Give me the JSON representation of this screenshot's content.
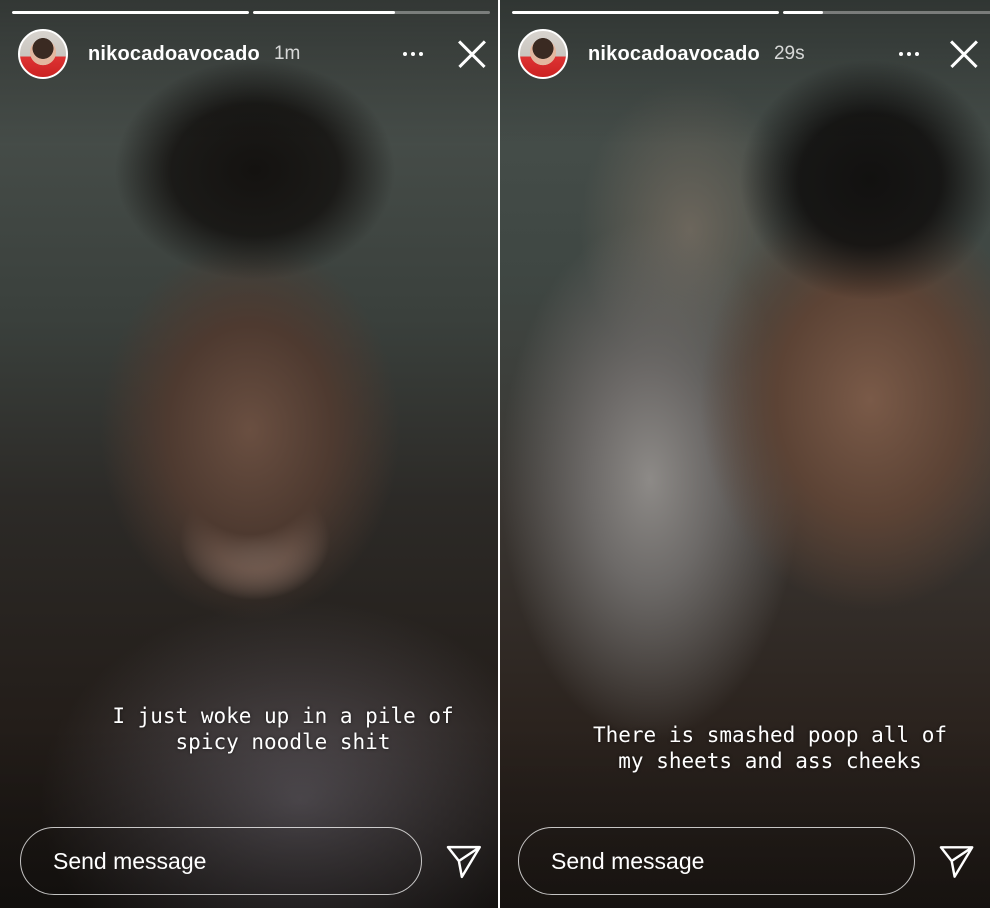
{
  "stories": [
    {
      "username": "nikocadoavocado",
      "timestamp": "1m",
      "caption": "I just woke up in a pile of\nspicy noodle shit",
      "send_placeholder": "Send message",
      "progress": [
        1,
        0.6
      ]
    },
    {
      "username": "nikocadoavocado",
      "timestamp": "29s",
      "caption": "There is smashed poop all of\nmy sheets and ass cheeks",
      "send_placeholder": "Send message",
      "progress": [
        1,
        0.15
      ]
    }
  ],
  "icons": {
    "more": "more-dots-icon",
    "close": "close-icon",
    "send": "paper-plane-icon"
  }
}
